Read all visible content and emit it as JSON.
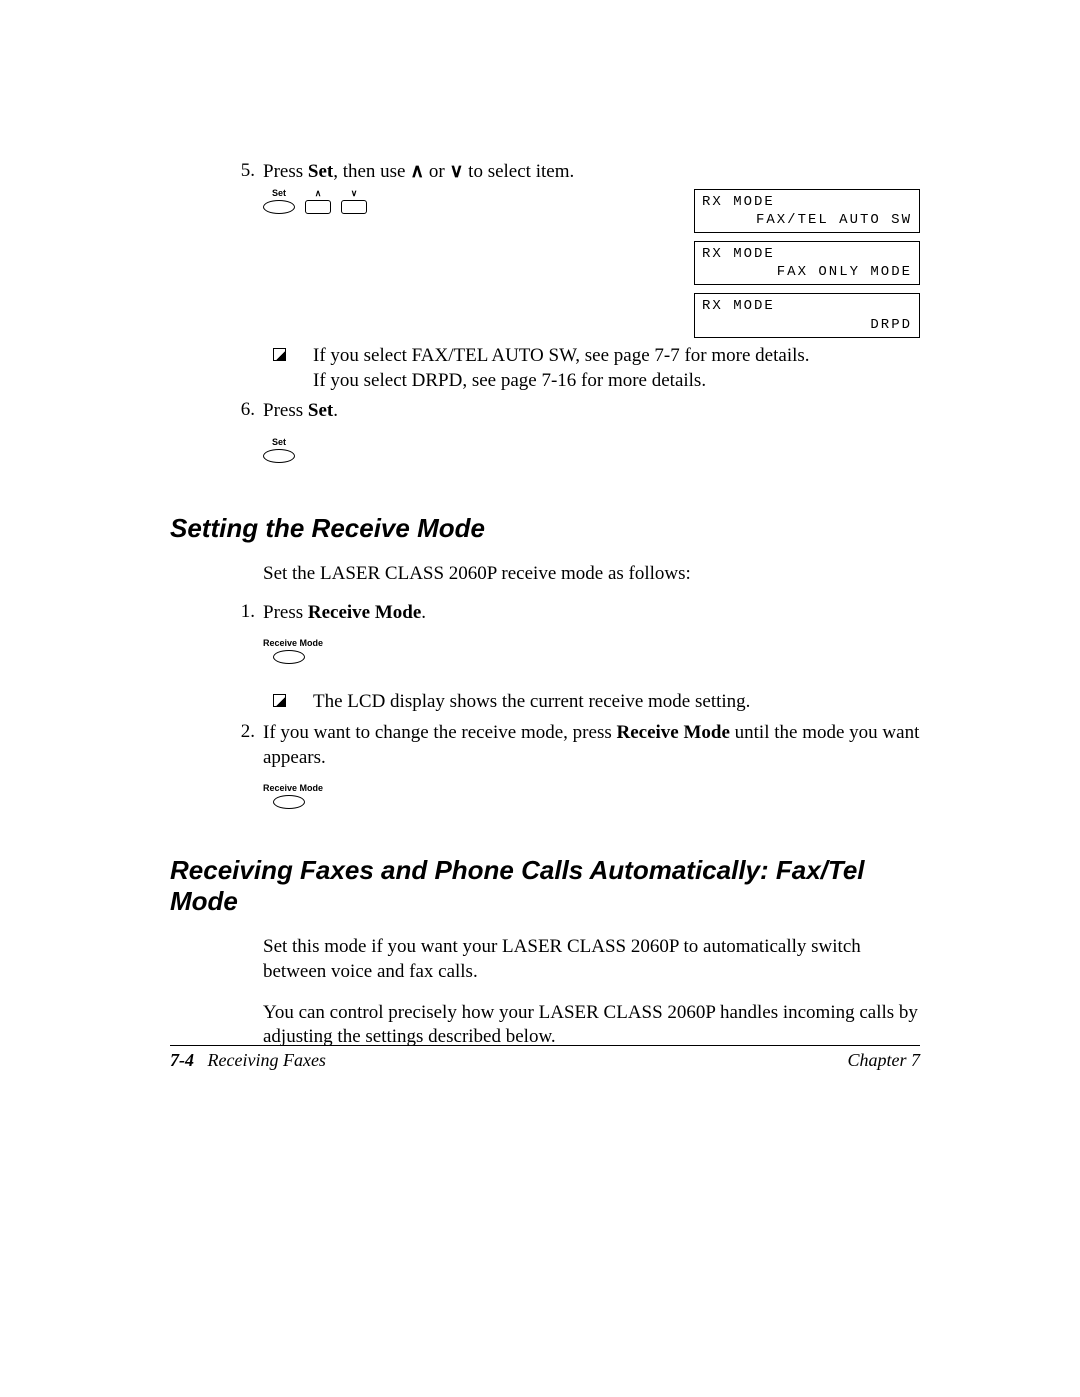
{
  "step5": {
    "num": "5.",
    "text_pre": "Press ",
    "text_set": "Set",
    "text_mid": ", then use ",
    "text_or": " or ",
    "text_post": " to select item.",
    "btn_set": "Set"
  },
  "lcd": [
    {
      "l1": "RX MODE",
      "l2": "FAX/TEL AUTO SW"
    },
    {
      "l1": "RX MODE",
      "l2": "FAX ONLY MODE"
    },
    {
      "l1": "RX MODE",
      "l2": "DRPD"
    }
  ],
  "note1": {
    "line1": "If you select FAX/TEL AUTO SW, see page 7-7 for more details.",
    "line2": "If you select DRPD, see page 7-16 for more details."
  },
  "step6": {
    "num": "6.",
    "text_pre": "Press ",
    "text_set": "Set",
    "text_post": ".",
    "btn_set": "Set"
  },
  "section1": {
    "heading": "Setting the Receive Mode",
    "intro": "Set the LASER CLASS 2060P receive mode as follows:"
  },
  "s1_step1": {
    "num": "1.",
    "text_pre": "Press ",
    "text_bold": "Receive Mode",
    "text_post": ".",
    "btn_label": "Receive Mode"
  },
  "s1_note": "The LCD display shows the current receive mode setting.",
  "s1_step2": {
    "num": "2.",
    "text_pre": "If you want to change the receive mode, press ",
    "text_bold": "Receive Mode",
    "text_post": " until the mode you want appears.",
    "btn_label": "Receive Mode"
  },
  "section2": {
    "heading": "Receiving Faxes and Phone Calls Automatically: Fax/Tel Mode",
    "p1": "Set this mode if you want your LASER CLASS 2060P to automatically switch between voice and fax calls.",
    "p2": "You can control precisely how your LASER CLASS 2060P handles incoming calls by adjusting the settings described below."
  },
  "footer": {
    "page": "7-4",
    "section": "Receiving Faxes",
    "chapter": "Chapter 7"
  }
}
